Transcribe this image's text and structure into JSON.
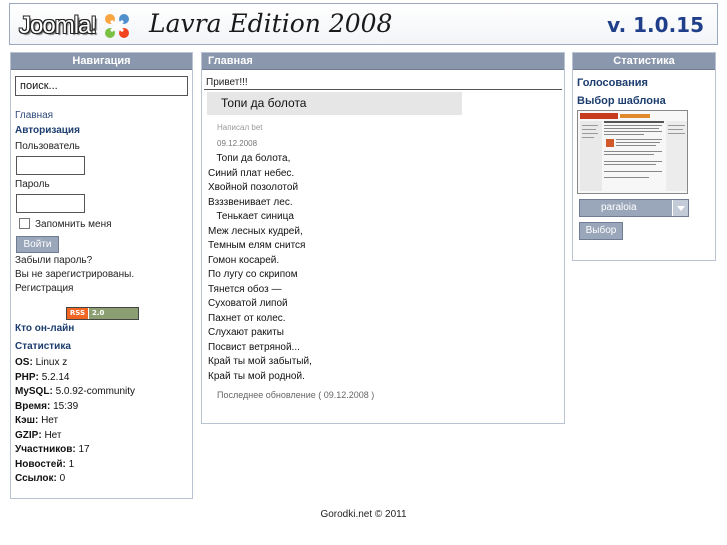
{
  "header": {
    "logo_text": "Joomla!",
    "edition_text": "Lavra Edition 2008",
    "version": "v. 1.0.15"
  },
  "left": {
    "title": "Навигация",
    "search_placeholder": "поиск...",
    "home_link": "Главная",
    "auth_heading": "Авторизация",
    "username_label": "Пользователь",
    "password_label": "Пароль",
    "remember_label": "Запомнить меня",
    "login_button": "Войти",
    "forgot_link": "Забыли пароль?",
    "not_registered": "Вы не зарегистрированы.",
    "register_link": "Регистрация",
    "rss_left": "RSS",
    "rss_right": "2.0",
    "online_heading": "Кто он-лайн",
    "stats_heading": "Статистика",
    "stats": [
      {
        "key": "OS:",
        "value": "Linux z"
      },
      {
        "key": "PHP:",
        "value": "5.2.14"
      },
      {
        "key": "MySQL:",
        "value": "5.0.92-community"
      },
      {
        "key": "Время:",
        "value": "15:39"
      },
      {
        "key": "Кэш:",
        "value": "Нет"
      },
      {
        "key": "GZIP:",
        "value": "Нет"
      },
      {
        "key": "Участников:",
        "value": "17"
      },
      {
        "key": "Новостей:",
        "value": "1"
      },
      {
        "key": "Ссылок:",
        "value": "0"
      }
    ]
  },
  "center": {
    "title": "Главная",
    "greeting": "Привет!!!",
    "article_title": "Топи да болота",
    "author": "Написал bet",
    "date": "09.12.2008",
    "poem": [
      "   Топи да болота,",
      "Синий плат небес.",
      "Хвойной позолотой",
      "Взззвенивает лес.",
      "   Тенькает синица",
      "Меж лесных кудрей,",
      "Темным елям снится",
      "Гомон косарей.",
      "По лугу со скрипом",
      "Тянется обоз —",
      "Суховатой липой",
      "Пахнет от колес.",
      "Слухают ракиты",
      "Посвист ветряной...",
      "Край ты мой забытый,",
      "Край ты мой родной."
    ],
    "updated": "Последнее обновление ( 09.12.2008 )"
  },
  "right": {
    "title": "Статистика",
    "polls_heading": "Голосования",
    "template_heading": "Выбор шаблона",
    "template_selected": "paraloia",
    "select_button": "Выбор"
  },
  "footer": {
    "text": "Gorodki.net © 2011"
  }
}
